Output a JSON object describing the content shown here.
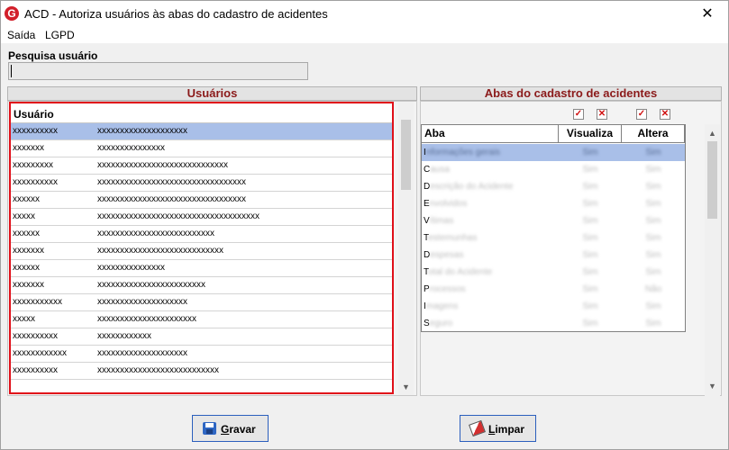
{
  "window": {
    "title": "ACD - Autoriza usuários às abas do cadastro de acidentes",
    "logo_letter": "G",
    "close_glyph": "✕",
    "brand_color": "#d21f2a"
  },
  "menu": {
    "items": [
      "Saída",
      "LGPD"
    ]
  },
  "search": {
    "label": "Pesquisa usuário",
    "value": ""
  },
  "users_panel": {
    "title": "Usuários",
    "column_header": "Usuário",
    "rows": [
      {
        "login": "xxxxxxxxxx",
        "name": "xxxxxxxxxxxxxxxxxxxx"
      },
      {
        "login": "xxxxxxx",
        "name": "xxxxxxxxxxxxxxx"
      },
      {
        "login": "xxxxxxxxx",
        "name": "xxxxxxxxxxxxxxxxxxxxxxxxxxxxx"
      },
      {
        "login": "xxxxxxxxxx",
        "name": "xxxxxxxxxxxxxxxxxxxxxxxxxxxxxxxxx"
      },
      {
        "login": "xxxxxx",
        "name": "xxxxxxxxxxxxxxxxxxxxxxxxxxxxxxxxx"
      },
      {
        "login": "xxxxx",
        "name": "xxxxxxxxxxxxxxxxxxxxxxxxxxxxxxxxxxxx"
      },
      {
        "login": "xxxxxx",
        "name": "xxxxxxxxxxxxxxxxxxxxxxxxxx"
      },
      {
        "login": "xxxxxxx",
        "name": "xxxxxxxxxxxxxxxxxxxxxxxxxxxx"
      },
      {
        "login": "xxxxxx",
        "name": "xxxxxxxxxxxxxxx"
      },
      {
        "login": "xxxxxxx",
        "name": "xxxxxxxxxxxxxxxxxxxxxxxx"
      },
      {
        "login": "xxxxxxxxxxx",
        "name": "xxxxxxxxxxxxxxxxxxxx"
      },
      {
        "login": "xxxxx",
        "name": "xxxxxxxxxxxxxxxxxxxxxx"
      },
      {
        "login": "xxxxxxxxxx",
        "name": "xxxxxxxxxxxx"
      },
      {
        "login": "xxxxxxxxxxxx",
        "name": "xxxxxxxxxxxxxxxxxxxx"
      },
      {
        "login": "xxxxxxxxxx",
        "name": "xxxxxxxxxxxxxxxxxxxxxxxxxxx"
      }
    ]
  },
  "abas_panel": {
    "title": "Abas do cadastro de acidentes",
    "check_glyph": "✓",
    "cross_glyph": "✕",
    "headers": {
      "aba": "Aba",
      "visualiza": "Visualiza",
      "altera": "Altera"
    },
    "rows": [
      {
        "first": "I",
        "rest": "nformações gerais",
        "visualiza": "Sim",
        "altera": "Sim"
      },
      {
        "first": "C",
        "rest": "ausa",
        "visualiza": "Sim",
        "altera": "Sim"
      },
      {
        "first": "D",
        "rest": "escrição do Acidente",
        "visualiza": "Sim",
        "altera": "Sim"
      },
      {
        "first": "E",
        "rest": "nvolvidos",
        "visualiza": "Sim",
        "altera": "Sim"
      },
      {
        "first": "V",
        "rest": "ítimas",
        "visualiza": "Sim",
        "altera": "Sim"
      },
      {
        "first": "T",
        "rest": "estemunhas",
        "visualiza": "Sim",
        "altera": "Sim"
      },
      {
        "first": "D",
        "rest": "espesas",
        "visualiza": "Sim",
        "altera": "Sim"
      },
      {
        "first": "T",
        "rest": "otal do Acidente",
        "visualiza": "Sim",
        "altera": "Sim"
      },
      {
        "first": "P",
        "rest": "rocessos",
        "visualiza": "Sim",
        "altera": "Não"
      },
      {
        "first": "I",
        "rest": "magens",
        "visualiza": "Sim",
        "altera": "Sim"
      },
      {
        "first": "S",
        "rest": "eguro",
        "visualiza": "Sim",
        "altera": "Sim"
      }
    ]
  },
  "buttons": {
    "save_first": "G",
    "save_rest": "ravar",
    "clear_first": "L",
    "clear_rest": "impar"
  }
}
